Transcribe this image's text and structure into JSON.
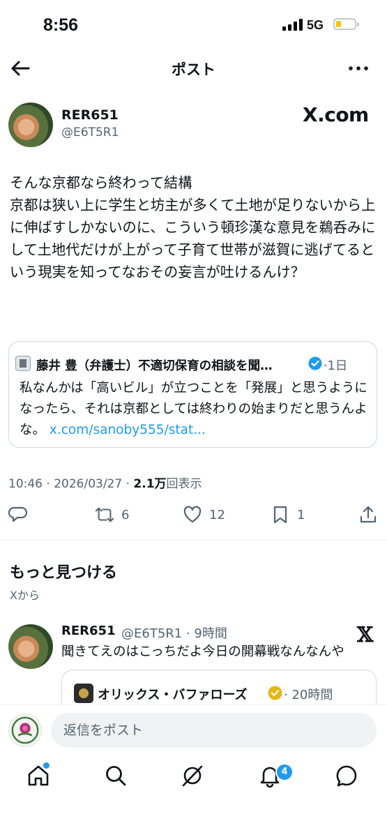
{
  "status_bar": {
    "time": "8:56",
    "network": "5G",
    "battery_level": 0.25,
    "battery_color": "#f5c400"
  },
  "header": {
    "title": "ポスト",
    "back_icon": "arrow-left-icon",
    "more_icon": "more-horizontal-icon"
  },
  "post": {
    "user_name": "RER651",
    "handle": "@E6T5R1",
    "watermark": "X.com",
    "text": "そんな京都なら終わって結構\n京都は狭い上に学生と坊主が多くて土地が足りないから上に伸ばすしかないのに、こういう頓珍漢な意見を鵜呑みにして土地代だけが上がって子育て世帯が滋賀に逃げてるという現実を知ってなおその妄言が吐けるんけ？",
    "quote": {
      "author": "藤井 豊（弁護士）不適切保育の相談を聞…",
      "time": "·1日",
      "text": "私なんかは「高いビル」が立つことを「発展」と思うようになったら、それは京都としては終わりの始まりだと思うんよな。",
      "link": "x.com/sanoby555/stat..."
    },
    "meta": {
      "timestamp": "10:46 · 2026/03/27 · ",
      "views": "2.1万",
      "views_suffix": "回表示"
    },
    "actions": {
      "reposts": "6",
      "likes": "12",
      "bookmarks": "1"
    }
  },
  "discover": {
    "title": "もっと見つける",
    "subtitle": "Xから",
    "rec": {
      "user_name": "RER651",
      "handle_time": "@E6T5R1 · 9時間",
      "text": "聞きてえのはこっちだよ今日の開幕戦なんなんや",
      "quote_author": "オリックス・バファローズ",
      "quote_time": "· 20時間"
    }
  },
  "reply": {
    "placeholder": "返信をポスト"
  },
  "bottom_nav": {
    "notifications_count": "4",
    "accent": "#1d9bf0"
  }
}
